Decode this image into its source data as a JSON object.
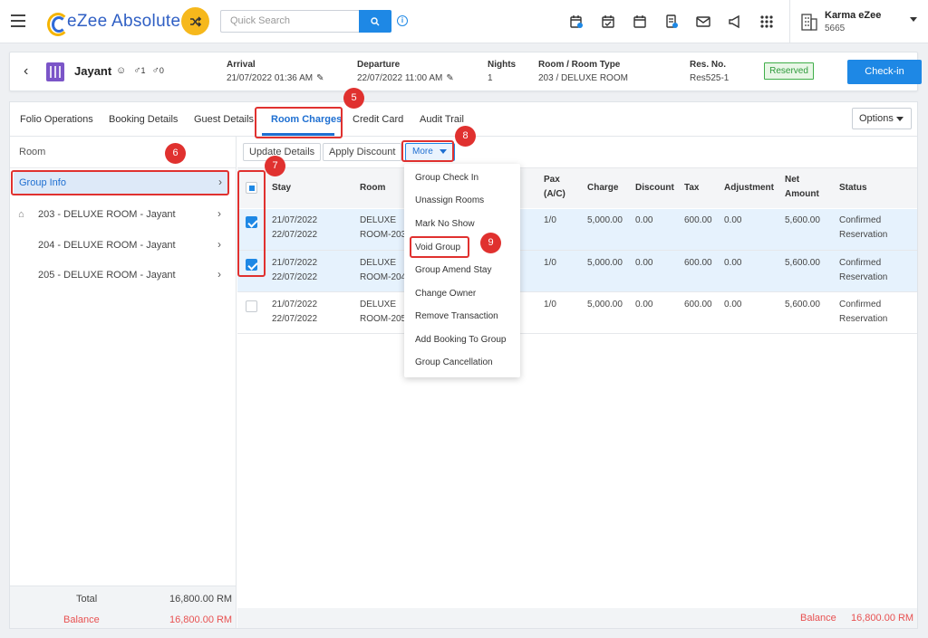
{
  "topbar": {
    "logo_text": "eZee Absolute",
    "search_placeholder": "Quick Search",
    "user_name": "Karma eZee",
    "user_code": "5665"
  },
  "reservation": {
    "guest_name": "Jayant",
    "adults": "1",
    "children": "0",
    "arrival_label": "Arrival",
    "arrival_value": "21/07/2022 01:36 AM",
    "departure_label": "Departure",
    "departure_value": "22/07/2022 11:00 AM",
    "nights_label": "Nights",
    "nights_value": "1",
    "room_label": "Room / Room Type",
    "room_value": "203 / DELUXE ROOM",
    "resno_label": "Res. No.",
    "resno_value": "Res525-1",
    "status_badge": "Reserved",
    "checkin_label": "Check-in"
  },
  "tabs": [
    "Folio Operations",
    "Booking Details",
    "Guest Details",
    "Room Charges",
    "Credit Card",
    "Audit Trail"
  ],
  "options_label": "Options",
  "sidebar": {
    "title": "Room",
    "group_info": "Group Info",
    "rooms": [
      "203 - DELUXE ROOM - Jayant",
      "204 - DELUXE ROOM - Jayant",
      "205 - DELUXE ROOM - Jayant"
    ],
    "total_label": "Total",
    "total_value": "16,800.00 RM",
    "balance_label": "Balance",
    "balance_value": "16,800.00 RM"
  },
  "toolbar": {
    "update_details": "Update Details",
    "apply_discount": "Apply Discount",
    "more": "More"
  },
  "grid": {
    "headers": {
      "stay": "Stay",
      "room": "Room",
      "pax_1": "Pax",
      "pax_2": "(A/C)",
      "charge": "Charge",
      "discount": "Discount",
      "tax": "Tax",
      "adjustment": "Adjustment",
      "net_1": "Net",
      "net_2": "Amount",
      "status": "Status"
    },
    "rows": [
      {
        "stay_1": "21/07/2022",
        "stay_2": "22/07/2022",
        "room_1": "DELUXE",
        "room_2": "ROOM-203",
        "pax": "1/0",
        "charge": "5,000.00",
        "discount": "0.00",
        "tax": "600.00",
        "adjustment": "0.00",
        "net": "5,600.00",
        "status_1": "Confirmed",
        "status_2": "Reservation"
      },
      {
        "stay_1": "21/07/2022",
        "stay_2": "22/07/2022",
        "room_1": "DELUXE",
        "room_2": "ROOM-204",
        "pax": "1/0",
        "charge": "5,000.00",
        "discount": "0.00",
        "tax": "600.00",
        "adjustment": "0.00",
        "net": "5,600.00",
        "status_1": "Confirmed",
        "status_2": "Reservation"
      },
      {
        "stay_1": "21/07/2022",
        "stay_2": "22/07/2022",
        "room_1": "DELUXE",
        "room_2": "ROOM-205",
        "pax": "1/0",
        "charge": "5,000.00",
        "discount": "0.00",
        "tax": "600.00",
        "adjustment": "0.00",
        "net": "5,600.00",
        "status_1": "Confirmed",
        "status_2": "Reservation"
      }
    ],
    "balance_label": "Balance",
    "balance_value": "16,800.00 RM"
  },
  "more_menu": [
    "Group Check In",
    "Unassign Rooms",
    "Mark No Show",
    "Void Group",
    "Group Amend Stay",
    "Change Owner",
    "Remove Transaction",
    "Add Booking To Group",
    "Group Cancellation"
  ],
  "markers": [
    "5",
    "6",
    "7",
    "8",
    "9"
  ],
  "colors": {
    "accent": "#1e88e5",
    "highlight": "#e0312f",
    "reserved": "#2e9a3b",
    "balance": "#e85151",
    "shuffle": "#f6b81c"
  }
}
